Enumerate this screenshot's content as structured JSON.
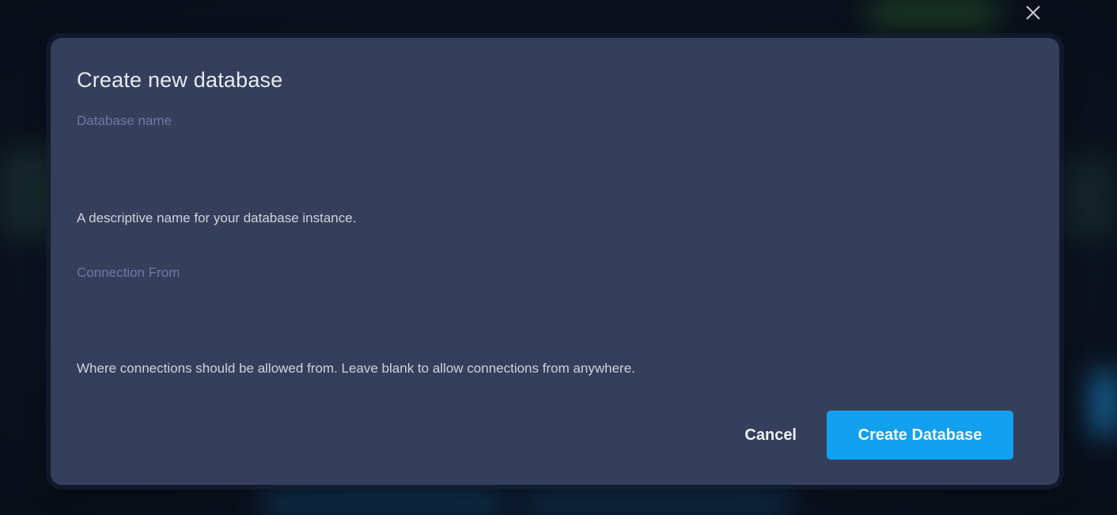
{
  "dialog": {
    "title": "Create new database",
    "close_icon": "close-icon",
    "fields": {
      "database_name": {
        "value": "",
        "placeholder": "Database name",
        "helper": "A descriptive name for your database instance."
      },
      "connection_from": {
        "value": "",
        "placeholder": "Connection From",
        "helper": "Where connections should be allowed from. Leave blank to allow connections from anywhere."
      }
    },
    "actions": {
      "cancel_label": "Cancel",
      "create_label": "Create Database"
    }
  },
  "colors": {
    "modal_bg": "#353f5b",
    "primary_button": "#12a0ee",
    "placeholder": "#6c7aa5"
  }
}
